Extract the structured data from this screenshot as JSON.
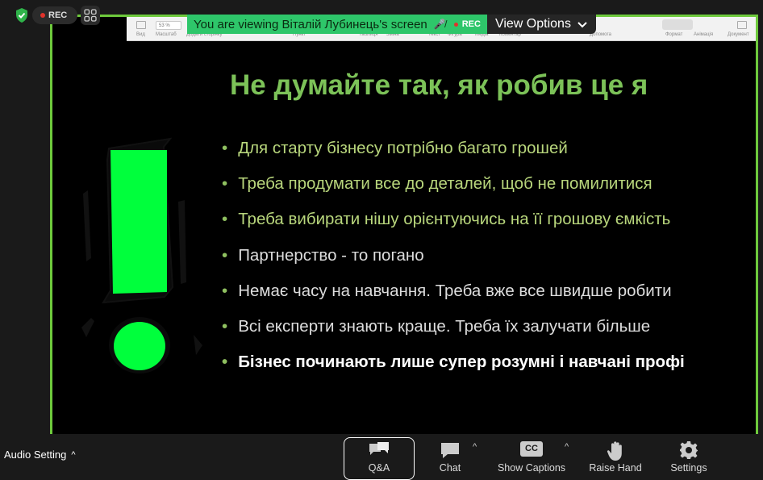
{
  "security_icon": "shield-check-icon",
  "recording": {
    "label": "REC"
  },
  "share_banner": {
    "text": "You are viewing Віталій Лубинець's screen",
    "mic_icon": "mic-off-icon",
    "rec_label": "REC",
    "view_options_label": "View Options"
  },
  "presenter_toolbar": {
    "labels": [
      "Вид",
      "Масштаб",
      "Додати сторінку",
      "Пункт",
      "Таблиця",
      "Зміна",
      "Текст",
      "Фігура",
      "Медіа",
      "Коментар",
      "Допомога",
      "Формат",
      "Анімація",
      "Документ"
    ]
  },
  "slide": {
    "title": "Не думайте так, як робив це я",
    "bullets": [
      "Для старту бізнесу потрібно багато грошей",
      "Треба продумати все до деталей, щоб не помилитися",
      "Треба вибирати нішу орієнтуючись на її грошову ємкість",
      "Партнерство - то погано",
      "Немає часу на навчання. Треба вже все швидше робити",
      "Всі експерти знають краще. Треба їх залучати більше",
      "Бізнес починають лише супер розумні і навчані профі"
    ]
  },
  "controls": {
    "audio_setting": "Audio Setting",
    "qa": "Q&A",
    "chat": "Chat",
    "show_captions": "Show Captions",
    "captions_icon_text": "CC",
    "raise_hand": "Raise Hand",
    "settings": "Settings"
  },
  "colors": {
    "accent_green": "#6ec93c",
    "banner_green": "#2ec66a",
    "title_green": "#7cc258",
    "exclaim_green": "#00ff3c"
  }
}
